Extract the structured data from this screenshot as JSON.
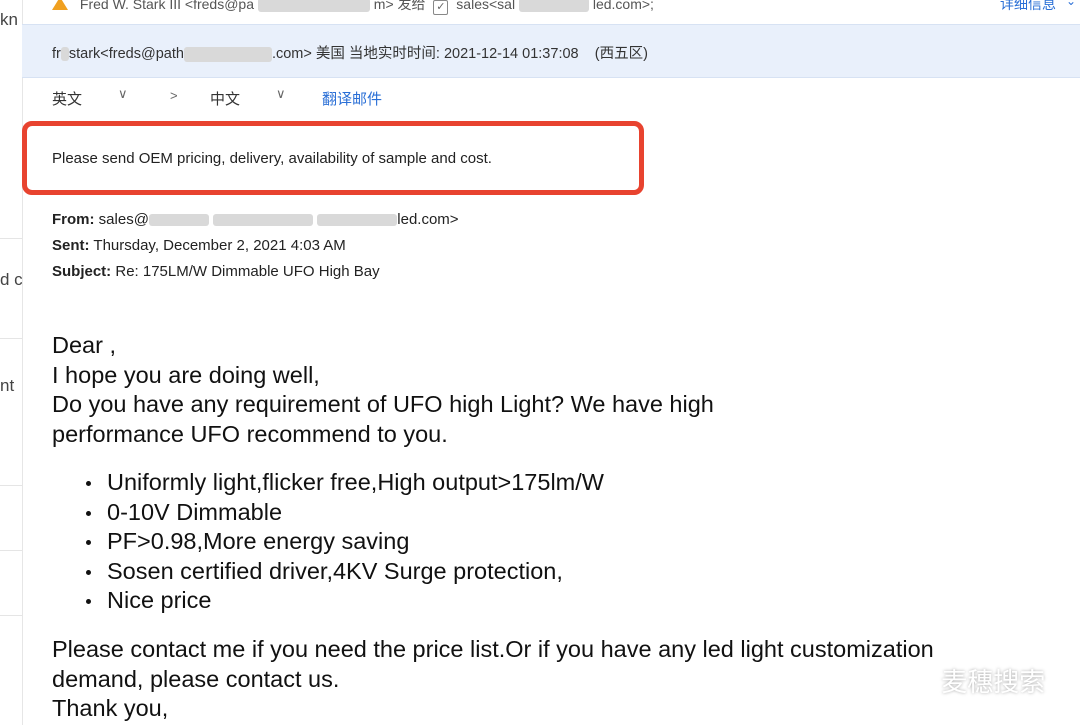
{
  "left_pane": {
    "fragments": [
      "kn",
      "d c",
      "nt"
    ]
  },
  "top_line": {
    "sender": "Fred W. Stark III <freds@pa",
    "sender_tail": "m>",
    "sent_label": "发给",
    "recipient": "sales<sal",
    "recipient_tail": "led.com>;",
    "details_link": "详细信息"
  },
  "info_bar": {
    "from_prefix": "fr",
    "from_mid": "stark<freds@path",
    "from_suffix": ".com>",
    "location_label": "美国 当地实时时间:",
    "timestamp": "2021-12-14 01:37:08",
    "timezone": "(西五区)"
  },
  "translate_bar": {
    "source_lang": "英文",
    "arrow": ">",
    "target_lang": "中文",
    "translate_link": "翻译邮件"
  },
  "highlight_line": "Please send OEM pricing, delivery, availability of sample and cost.",
  "quoted_header": {
    "from_label": "From:",
    "from_value_prefix": "sales@",
    "from_value_suffix": "led.com>",
    "sent_label": "Sent:",
    "sent_value": "Thursday, December 2, 2021 4:03 AM",
    "subject_label": "Subject:",
    "subject_value": "Re: 175LM/W Dimmable UFO High Bay"
  },
  "body": {
    "greeting": "Dear ,",
    "line1": "I hope you are doing well,",
    "line2": "Do you have any requirement of UFO high Light? We have high",
    "line3": "performance UFO recommend to you.",
    "bullets": [
      "Uniformly light,flicker free,High output>175lm/W",
      "0-10V Dimmable",
      "PF>0.98,More energy saving",
      "Sosen certified driver,4KV Surge protection,",
      "Nice price"
    ],
    "closing1": "Please contact me if you need the price list.Or if you have any led light customization",
    "closing2": "demand, please contact us.",
    "closing3": "Thank you,"
  },
  "watermark": {
    "text": "麦穗搜索"
  },
  "colors": {
    "accent": "#2a6fd6",
    "highlight_border": "#e8432f",
    "info_bar_bg": "#e9f0fb"
  }
}
